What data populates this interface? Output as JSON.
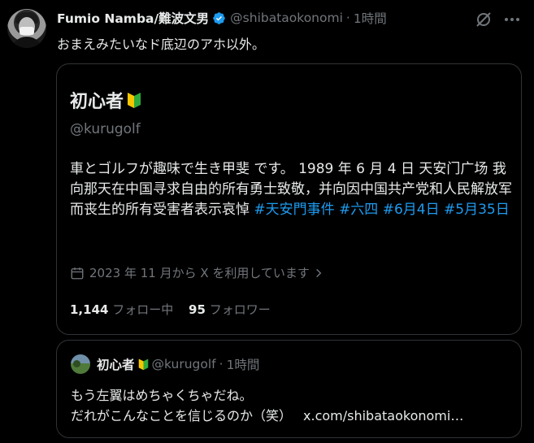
{
  "tweet": {
    "author_name": "Fumio Namba/難波文男",
    "handle": "@shibataokonomi",
    "separator": "·",
    "time": "1時間",
    "text": "おまえみたいなド底辺のアホ以外。",
    "icons": {
      "verified": "verified-badge-icon",
      "grok": "grok-icon",
      "more": "more-icon"
    },
    "accent_color": "#1d9bf0"
  },
  "profile_card": {
    "name": "初心者",
    "badge_icon": "beginner-mark-icon",
    "handle": "@kurugolf",
    "bio_text": "車とゴルフが趣味で生き甲斐 です。 1989 年 6 月 4 日 天安门广场 我向那天在中国寻求自由的所有勇士致敬，并向因中国共产党和人民解放军而丧生的所有受害者表示哀悼 ",
    "hashtags": [
      "#天安門事件",
      "#六四",
      "#6月4日",
      "#5月35日"
    ],
    "joined": "2023 年 11 月から X を利用しています",
    "following_count": "1,144",
    "following_label": "フォロー中",
    "followers_count": "95",
    "followers_label": "フォロワー"
  },
  "quote": {
    "name": "初心者",
    "handle": "@kurugolf",
    "separator": "·",
    "time": "1時間",
    "line1": "もう左翼はめちゃくちゃだね。",
    "line2": "だれがこんなことを信じるのか（笑）",
    "link": "x.com/shibataokonomi…"
  }
}
